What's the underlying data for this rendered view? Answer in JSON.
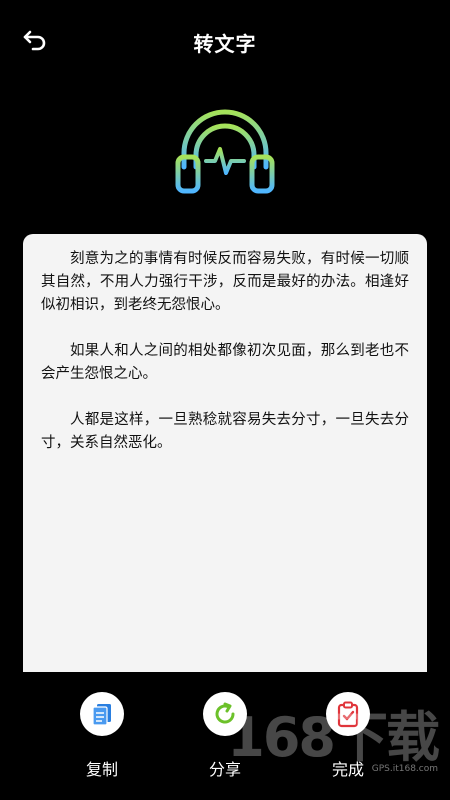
{
  "header": {
    "title": "转文字",
    "back_icon": "back-arrow-icon"
  },
  "hero": {
    "icon": "headphone-pulse-icon",
    "gradient": [
      "#a6e35a",
      "#4fb6ff"
    ]
  },
  "content": {
    "paragraphs": [
      "刻意为之的事情有时候反而容易失败，有时候一切顺其自然，不用人力强行干涉，反而是最好的办法。相逢好似初相识，到老终无怨恨心。",
      "如果人和人之间的相处都像初次见面，那么到老也不会产生怨恨之心。",
      "人都是这样，一旦熟稔就容易失去分寸，一旦失去分寸，关系自然恶化。"
    ]
  },
  "actions": {
    "copy": {
      "label": "复制",
      "icon": "copy-icon",
      "color": "#2a7fe0"
    },
    "share": {
      "label": "分享",
      "icon": "share-refresh-icon",
      "color": "#6cc12a"
    },
    "done": {
      "label": "完成",
      "icon": "clipboard-check-icon",
      "color": "#e0353b"
    }
  },
  "watermark": {
    "text": "168下载",
    "sub": "GPS.it168.com"
  }
}
